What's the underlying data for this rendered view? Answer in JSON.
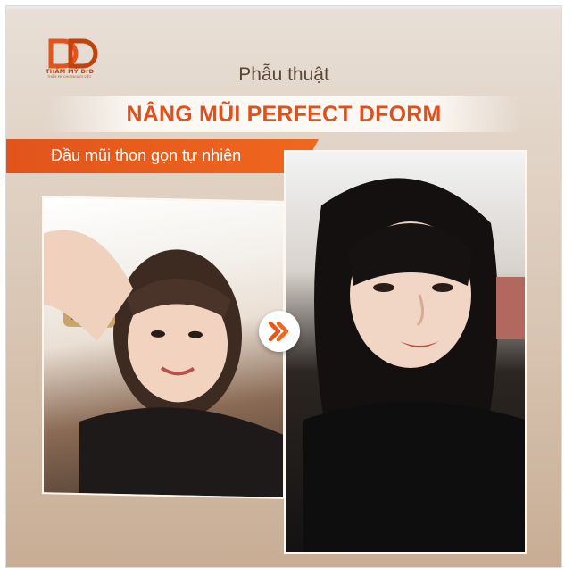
{
  "banner": {
    "logo": {
      "text": "THẨM MỸ DrD",
      "subtitle": "THẨM MỸ CHO NGƯỜI VIỆT"
    },
    "headline": "Phẫu thuật",
    "title": "NÂNG MŨI PERFECT DFORM",
    "feature": "Đầu mũi thon gọn tự nhiên",
    "connector_icon": "double-chevron-right-icon",
    "colors": {
      "accent": "#E0501C",
      "feature_bar": "#E95A1E",
      "headline": "#5A4636"
    }
  }
}
